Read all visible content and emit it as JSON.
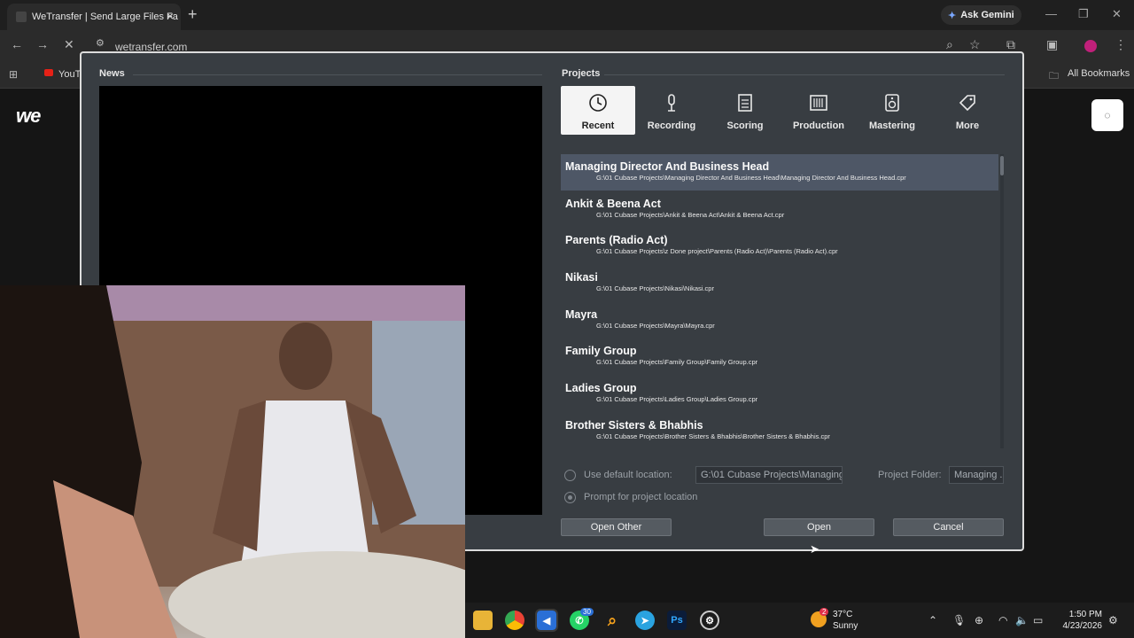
{
  "browser": {
    "tab_title": "WeTransfer | Send Large Files Fa",
    "gemini_label": "Ask Gemini",
    "url": "wetransfer.com",
    "bookmark_youtube": "YouT",
    "all_bookmarks": "All Bookmarks"
  },
  "site": {
    "logo": "we"
  },
  "dialog": {
    "news_title": "News",
    "projects_title": "Projects",
    "categories": [
      {
        "label": "Recent",
        "icon": "clock-icon"
      },
      {
        "label": "Recording",
        "icon": "microphone-icon"
      },
      {
        "label": "Scoring",
        "icon": "score-icon"
      },
      {
        "label": "Production",
        "icon": "mixer-icon"
      },
      {
        "label": "Mastering",
        "icon": "speaker-icon"
      },
      {
        "label": "More",
        "icon": "tag-icon"
      }
    ],
    "projects": [
      {
        "name": "Managing Director And Business Head",
        "path": "G:\\01 Cubase Projects\\Managing Director And Business Head\\Managing Director And Business Head.cpr"
      },
      {
        "name": "Ankit & Beena Act",
        "path": "G:\\01 Cubase Projects\\Ankit & Beena Act\\Ankit & Beena Act.cpr"
      },
      {
        "name": "Parents (Radio Act)",
        "path": "G:\\01 Cubase Projects\\z Done project\\Parents (Radio Act)\\Parents (Radio Act).cpr"
      },
      {
        "name": "Nikasi",
        "path": "G:\\01 Cubase Projects\\Nikasi\\Nikasi.cpr"
      },
      {
        "name": "Mayra",
        "path": "G:\\01 Cubase Projects\\Mayra\\Mayra.cpr"
      },
      {
        "name": "Family Group",
        "path": "G:\\01 Cubase Projects\\Family Group\\Family Group.cpr"
      },
      {
        "name": "Ladies Group",
        "path": "G:\\01 Cubase Projects\\Ladies Group\\Ladies Group.cpr"
      },
      {
        "name": "Brother Sisters & Bhabhis",
        "path": "G:\\01 Cubase Projects\\Brother Sisters & Bhabhis\\Brother Sisters & Bhabhis.cpr"
      }
    ],
    "use_default_label": "Use default location:",
    "default_location_value": "G:\\01 Cubase Projects\\Managing.",
    "project_folder_label": "Project Folder:",
    "project_folder_value": "Managing .",
    "prompt_label": "Prompt for project location",
    "open_other": "Open Other",
    "open": "Open",
    "cancel": "Cancel"
  },
  "taskbar": {
    "temperature": "37°C",
    "weather": "Sunny",
    "weather_badge": "2",
    "whatsapp_badge": "30",
    "time": "1:50 PM",
    "date": "4/23/2026"
  }
}
